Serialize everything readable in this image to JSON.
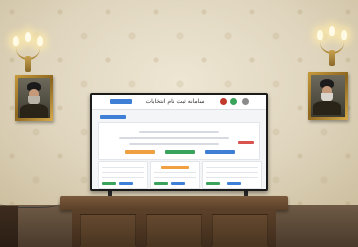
{
  "scene": {
    "description_items": [
      "wall",
      "wall-sconce-left",
      "wall-sconce-right",
      "portrait-left",
      "portrait-right",
      "television",
      "desk"
    ],
    "colors": {
      "wall": "#e0d6bf",
      "frame_gold": "#c79a3a",
      "desk_wood": "#6b4c31",
      "screen_bg": "#f4f5f7",
      "accent_blue": "#3f7fd6",
      "accent_green": "#3aa35b",
      "accent_orange": "#f0a040"
    }
  },
  "screen": {
    "title": "ﺳﺎﻣﺎﻧﻪ ﺛﺒﺖ ﻧﺎﻡ ﺍﻧﺘﺨﺎﺑﺎﺕ"
  }
}
